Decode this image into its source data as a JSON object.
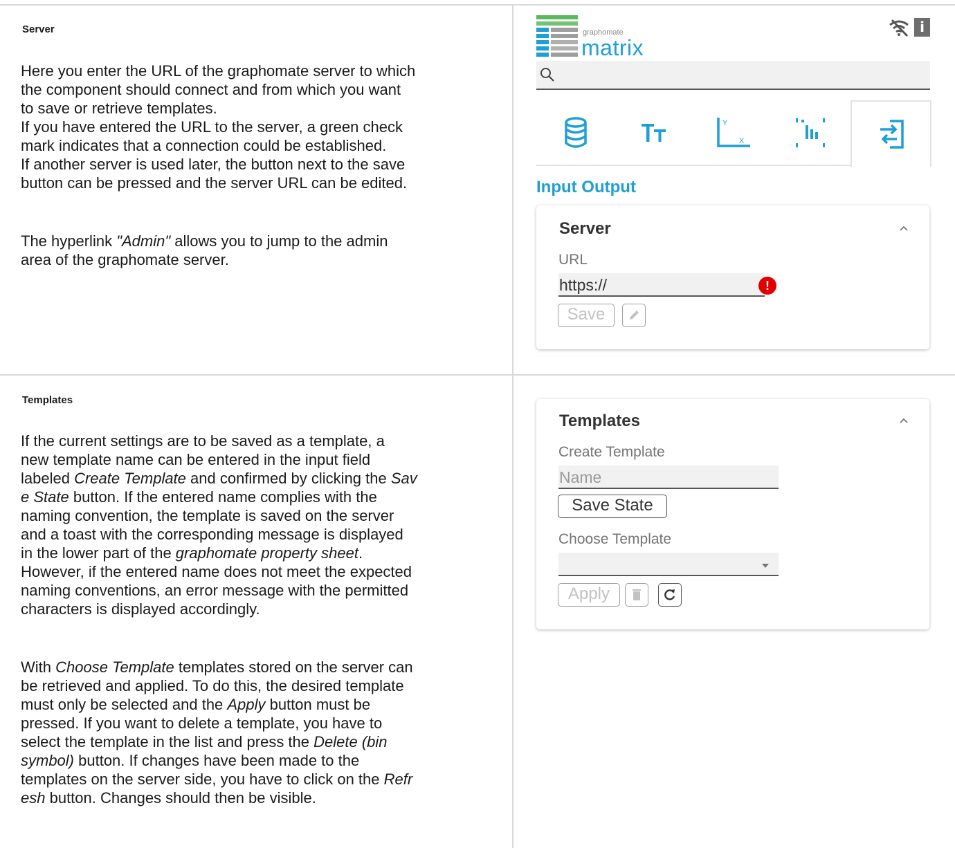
{
  "sections": {
    "server": {
      "title": "Server",
      "p1_lines": [
        "Here you enter the URL of the graphomate server to which",
        "the component should connect and from which you want",
        "to save or retrieve templates.",
        "If you have entered the URL to the server, a green check",
        "mark indicates that a connection could be established.",
        "If another server is used later, the button next to the save",
        "button can be pressed and the server URL can be edited."
      ],
      "p2": {
        "pre": "The hyperlink ",
        "link": "\"Admin\"",
        "post1": " allows you to jump to the admin",
        "line2": "area of the graphomate server."
      }
    },
    "templates": {
      "title": "Templates",
      "p1": {
        "l1": "If the current settings are to be saved as a template, a",
        "l2": "new template name can be entered in the input field",
        "l3_pre": "labeled ",
        "l3_em": "Create Template",
        "l3_mid": " and confirmed by clicking the ",
        "l3_em2": "Sav",
        "l4_em": "e State",
        "l4_post": " button. If the entered name complies with the",
        "l5": "naming convention, the template is saved on the server",
        "l6": "and a toast with the corresponding message is displayed",
        "l7_pre": "in the lower part of the ",
        "l7_em": "graphomate property sheet",
        "l7_post": ".",
        "l8": "However, if the entered name does not meet the expected",
        "l9": "naming conventions, an error message with the permitted",
        "l10": "characters is displayed accordingly."
      },
      "p2": {
        "l1_pre": "With ",
        "l1_em": "Choose Template",
        "l1_post": " templates stored on the server can",
        "l2": "be retrieved and applied. To do this, the desired template",
        "l3_pre": "must only be selected and the ",
        "l3_em": "Apply",
        "l3_post": " button must be",
        "l4": "pressed. If you want to delete a template, you have to",
        "l5_pre": "select the template in the list and press the ",
        "l5_em": "Delete (bin",
        "l6_em": "symbol)",
        "l6_post": " button. If changes have been made to the",
        "l7_pre": "templates on the server side, you have to click on the ",
        "l7_em": "Refr",
        "l8_em": "esh",
        "l8_post": " button. Changes should then be visible."
      }
    }
  },
  "panel": {
    "logo_small": "graphomate",
    "logo_big": "matrix",
    "logo_colors": [
      "#1e9fd6",
      "#5cb85c",
      "#9e9e9e"
    ],
    "accent": "#1e9fd6",
    "wifi_icon": "wifi-off-icon",
    "info_glyph": "i",
    "section_title": "Input Output",
    "tabs": [
      "database-icon",
      "text-size-icon",
      "axis-icon",
      "chart-icon",
      "input-output-icon"
    ],
    "active_tab": 4,
    "server_card": {
      "title": "Server",
      "url_label": "URL",
      "url_value": "https://",
      "save_label": "Save",
      "error_glyph": "!"
    },
    "templates_card": {
      "title": "Templates",
      "create_label": "Create Template",
      "name_placeholder": "Name",
      "save_state_label": "Save State",
      "choose_label": "Choose Template",
      "choose_value": "",
      "apply_label": "Apply"
    }
  }
}
